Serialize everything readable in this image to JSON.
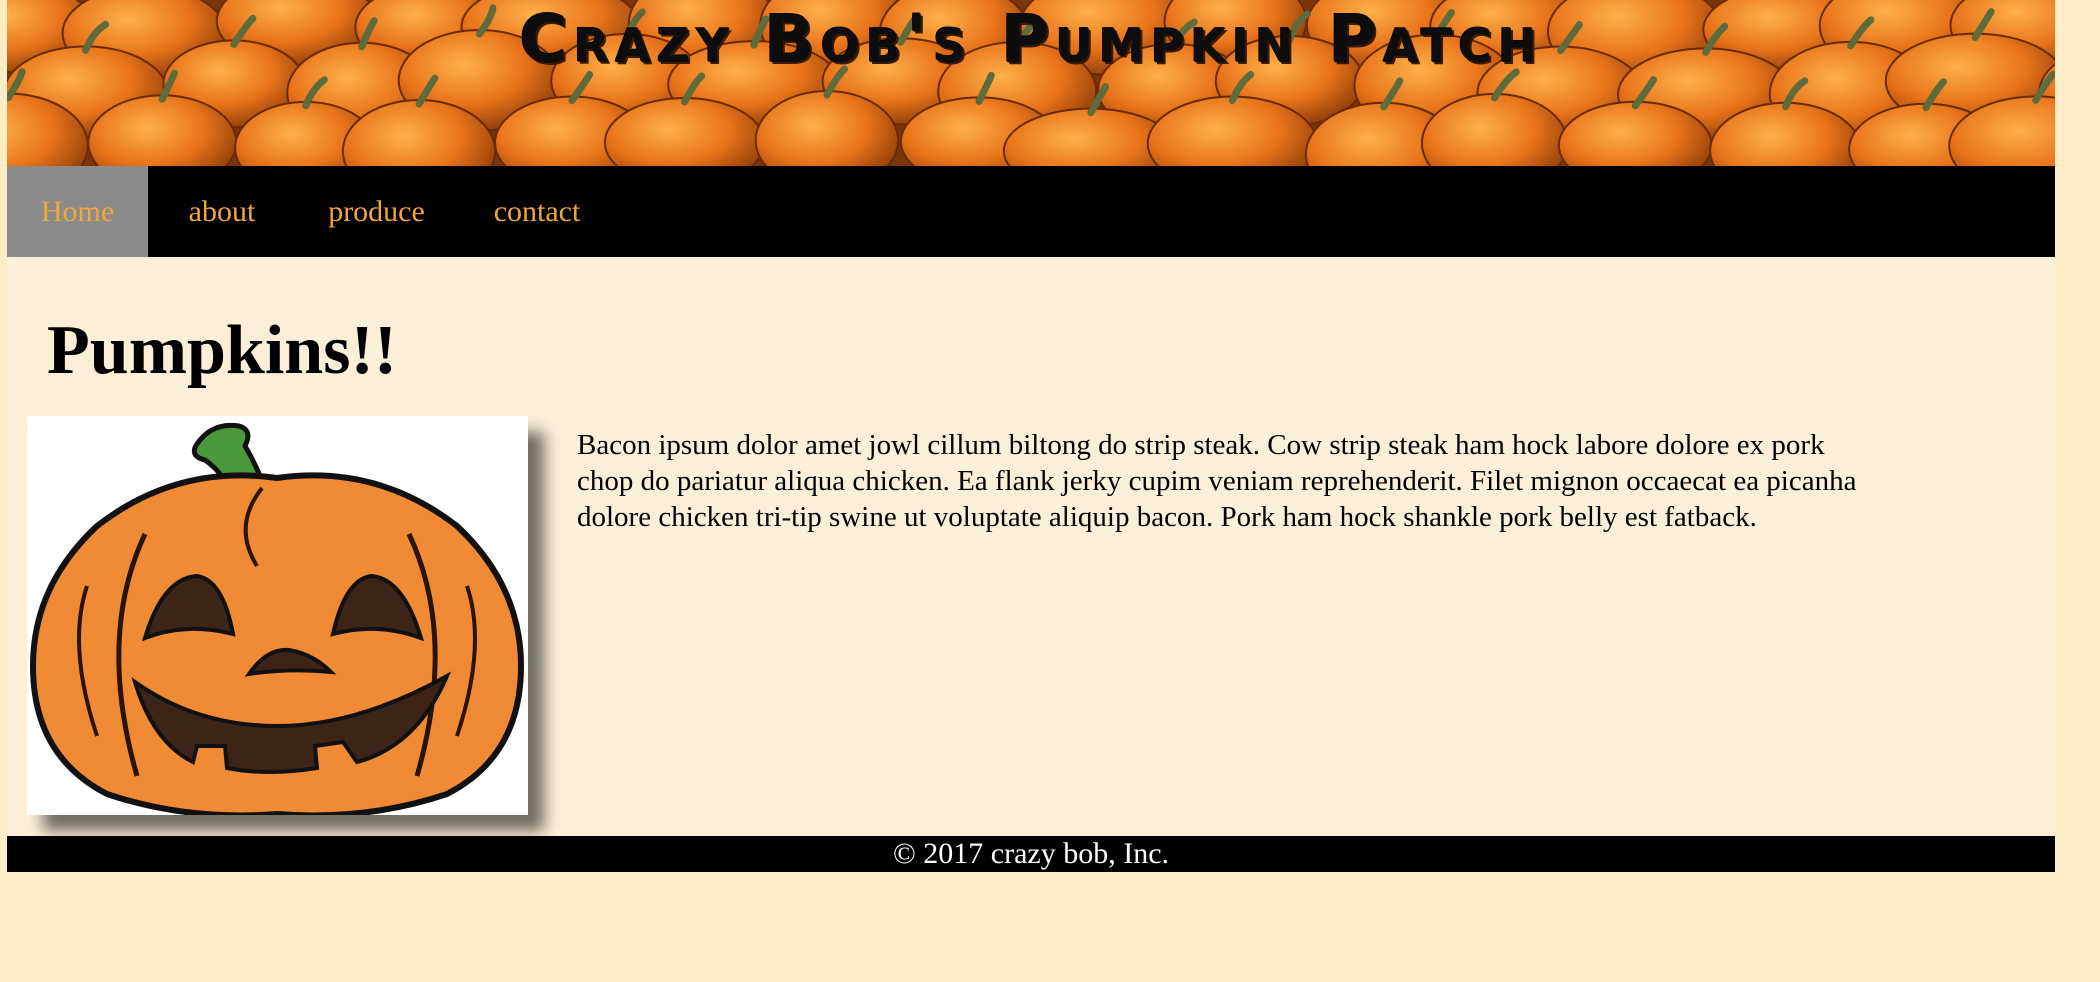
{
  "header": {
    "site_title": "Crazy Bob's Pumpkin Patch",
    "background_image": "pumpkin-field-banner"
  },
  "nav": {
    "items": [
      {
        "label": "Home",
        "active": true
      },
      {
        "label": "about",
        "active": false
      },
      {
        "label": "produce",
        "active": false
      },
      {
        "label": "contact",
        "active": false
      }
    ]
  },
  "main": {
    "heading": "Pumpkins!!",
    "image": "jack-o-lantern-cartoon",
    "paragraph": "Bacon ipsum dolor amet jowl cillum biltong do strip steak. Cow strip steak ham hock labore dolore ex pork chop do pariatur aliqua chicken. Ea flank jerky cupim veniam reprehenderit. Filet mignon occaecat ea picanha dolore chicken tri-tip swine ut voluptate aliquip bacon. Pork ham hock shankle pork belly est fatback."
  },
  "footer": {
    "copyright": "© 2017 crazy bob, Inc."
  },
  "colors": {
    "page_background": "#fcedc7",
    "content_background": "#fcefd8",
    "nav_background": "#000000",
    "nav_link": "#f0a63a",
    "nav_active_background": "#8b8b8b",
    "footer_text": "#ffffff"
  }
}
